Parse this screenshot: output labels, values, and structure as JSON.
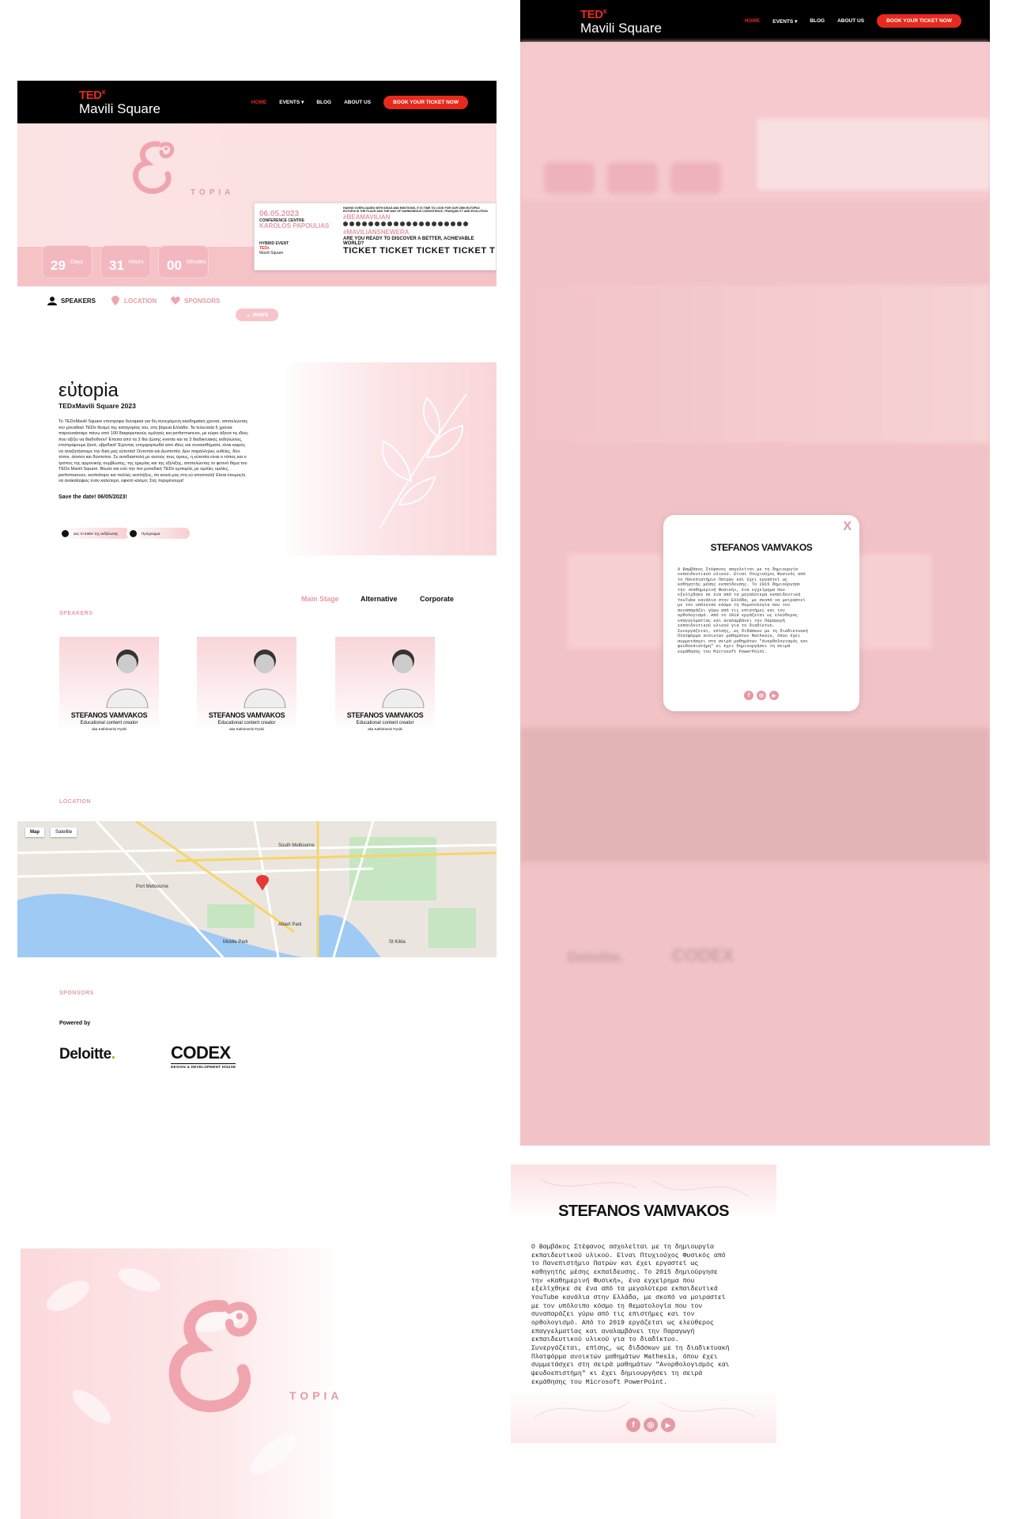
{
  "brand": {
    "ted": "TED",
    "x": "x",
    "location": "Mavili Square"
  },
  "nav": {
    "home": "HOME",
    "events": "EVENTS",
    "blog": "BLOG",
    "about": "ABOUT US",
    "ticket_button": "BOOK YOUR TICKET NOW"
  },
  "hero": {
    "emblem_text": "TOPIA",
    "countdown": [
      {
        "value": "29",
        "unit": "Days"
      },
      {
        "value": "31",
        "unit": "Hours"
      },
      {
        "value": "00",
        "unit": "Minutes"
      }
    ],
    "ticket": {
      "date": "06.05.2023",
      "venue_label": "CONFERENCE CENTRE",
      "venue": "KAROLOS PAPOULIAS",
      "event_type": "HYBRID EVENT",
      "org": "TEDx",
      "org_loc": "Mavili Square",
      "top_text": "HAVING OVERLOADED WITH IDEAS AND EMOTIONS, IT IS TIME TO LOOK FOR OUR OWN EUTOPIA! EUTOPIA IS THE PLACE AND THE WAY OF HARMONIOUS COEXISTENCE, TRANQUILITY AND EVOLUTION.",
      "hashtag1": "#BEAMAVILIAN",
      "hashtag2": "#MAVILIANSNEWERA",
      "question": "ARE YOU READY TO DISCOVER A BETTER, ACHIEVABLE WORLD?",
      "tickets": "TICKET TICKET TICKET TICKET TICKET"
    }
  },
  "tabs": {
    "speakers": "SPEAKERS",
    "location": "LOCATION",
    "sponsors": "SPONSORS",
    "more": "⌄ more"
  },
  "intro": {
    "title": "εὐtopia",
    "subtitle": "TEDxMavili Square 2023",
    "paragraph": "Το TEDxMavili Square επιστρέφει δυναμικά για 6η συνεχόμενη ακαδημαϊκή χρονιά, αποτελώντας τον μοναδικό TEDx θεσμό της κατηγορίας του, στη βόρεια Ελλάδα. Τα τελευταία 5 χρόνια παρουσιάσαμε πάνω από 100 διαφορετικούς ομιλητές και performances, με κύριο άξονα τις ιδέες που αξίζει να διαδοθούν! Έπειτα από τα 3 δια ζώσης events και τα 3 διαδικτυακές εκδηλώσεις, επιστρέφουμε ξανά, υβριδικά! Έχοντας υπερφορτωθεί από ιδέες και συναισθήματα, είναι καιρός να αναζητήσουμε την δική μας εὐτοπία! Ουτοπία και Δυστοπία. Δύο παράλληλες ευθείες, δύο τόποι, άτοποι και δύστοποι. Σε αντιδιαστολή με αυτούς τους όρους, η εὐτοπία είναι ο τόπος και ο τρόπος της αρμονικής συμβίωσης, της ηρεμίας και της εξέλιξης, αποτελώντας το φετινό θέμα του TEDx Mavili Square. Βίωσε και εσύ την πιο μοναδική TEDx εμπειρία, με ομιλίες ομιλίες, performances, workshops και πολλές εκπλήξεις, ότι κοινά μας στη εὐ αποστολή! Είσαι έτοιμος/η να ανακαλύψεις έναν καλύτερο, εφικτό κόσμο; Σας περιμένουμε!",
    "save_date": "Save the date! 06/05/2023!",
    "btn_trailer": "Δες το trailer της εκδήλωσης",
    "btn_program": "Πρόγραμμα"
  },
  "stages": {
    "main": "Main Stage",
    "alternative": "Alternative",
    "corporate": "Corporate"
  },
  "sections": {
    "speakers": "SPEAKERS",
    "location": "LOCATION",
    "sponsors": "SPONSORS",
    "powered_by": "Powered by"
  },
  "speakers": [
    {
      "name": "STEFANOS VAMVAKOS",
      "role": "Educational content creator",
      "aka": "aka Kathimerini Fysiki"
    },
    {
      "name": "STEFANOS VAMVAKOS",
      "role": "Educational content creator",
      "aka": "aka Kathimerini Fysiki"
    },
    {
      "name": "STEFANOS VAMVAKOS",
      "role": "Educational content creator",
      "aka": "aka Kathimerini Fysiki"
    }
  ],
  "map": {
    "map_tab": "Map",
    "satellite_tab": "Satellite",
    "labels": [
      "South Melbourne",
      "Port Melbourne",
      "Albert Park",
      "Middle Park",
      "St Kilda"
    ]
  },
  "sponsors": {
    "deloitte": "Deloitte",
    "deloitte_dot": ".",
    "codex": "CODEX",
    "codex_tag": "DESIGN & DEVELOPMENT HOUSE"
  },
  "modal": {
    "close": "X",
    "name": "STEFANOS VAMVAKOS",
    "bio": "Ο Βαμβάκος Στέφανος ασχολείται με τη δημιουργία\nεκπαιδευτικού υλικού. Είναι Πτυχιούχος Φυσικός από\nτο Πανεπιστήμιο Πατρών και έχει εργαστεί ως\nκαθηγητής μέσης εκπαίδευσης. Το 2015 δημιούργησε\nτην «Καθημερινή Φυσική», ένα εγχείρημα που\nεξελίχθηκε σε ένα από τα μεγαλύτερα εκπαιδευτικά\nYouTube κανάλια στην Ελλάδα, με σκοπό να μοιραστεί\nμε τον υπόλοιπο κόσμο τη θεματολογία που τον\nσυναπαράζει γύρω από τις επιστήμες και τον\nορθολογισμό. Από το 2019 εργάζεται ως ελεύθερος\nεπαγγελματίας και αναλαμβάνει την Παραγωγή\nεκπαιδευτικού υλικού για το διαδίκτυο.\nΣυνεργάζεται, επίσης, ως διδάσκων με τη διαδικτυακή\nΠλατφόρμα ανοικτών μαθημάτων Mathesis, όπου έχει\nσυμμετάσχει στη σειρά μαθημάτων \"Ανορθολογισμός και\nψευδοεπιστήμη\" κι έχει δημιουργήσει τη σειρά\nεκμάθησης του Microsoft PowerPoint.",
    "social": {
      "facebook": "f",
      "instagram": "◎",
      "youtube": "▶"
    }
  },
  "colors": {
    "accent": "#e62b1e",
    "pink": "#e49aa4",
    "overlay": "#f2c3c6"
  }
}
